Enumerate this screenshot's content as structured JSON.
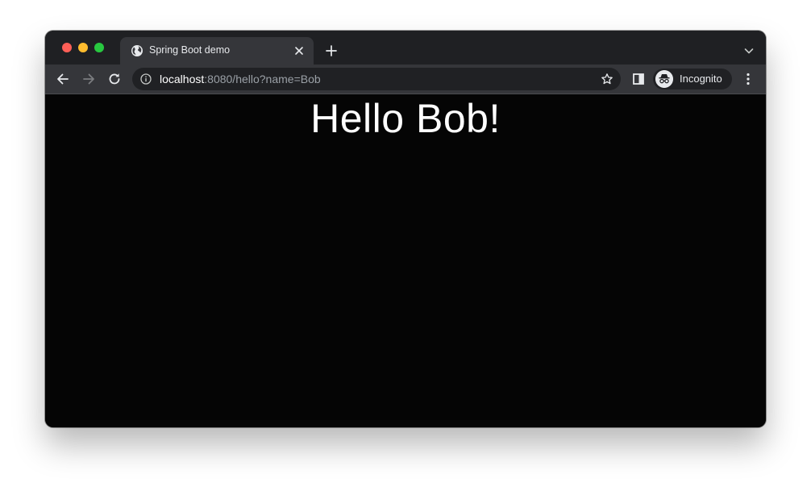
{
  "browser": {
    "tab": {
      "title": "Spring Boot demo",
      "favicon": "globe-icon"
    },
    "address_bar": {
      "host": "localhost",
      "rest": ":8080/hello?name=Bob"
    },
    "profile": {
      "label": "Incognito",
      "icon": "incognito-icon"
    },
    "colors": {
      "tab_strip": "#1f2023",
      "toolbar": "#35363a",
      "page_background": "#050505",
      "text_primary": "#e8eaed",
      "url_secondary": "#9aa0a6"
    }
  },
  "page": {
    "heading": "Hello Bob!"
  }
}
